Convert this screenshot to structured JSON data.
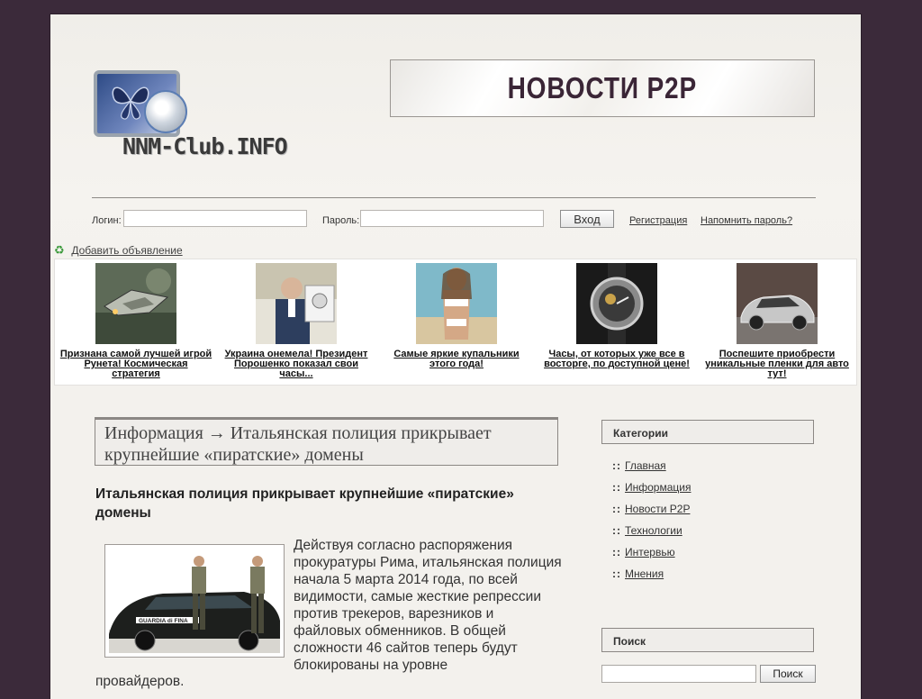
{
  "header": {
    "logo_text": "NNM-Club.INFO",
    "banner_title": "НОВОСТИ P2P"
  },
  "login": {
    "login_label": "Логин:",
    "password_label": "Пароль:",
    "login_value": "",
    "password_value": "",
    "submit_label": "Вход",
    "register_link": "Регистрация",
    "forgot_link": "Напомнить пароль?"
  },
  "ads": {
    "add_label": "Добавить объявление",
    "items": [
      {
        "caption": "Признана самой лучшей игрой Рунета! Космическая стратегия"
      },
      {
        "caption": "Украина онемела! Президент Порошенко показал свои часы..."
      },
      {
        "caption": "Самые яркие купальники этого года!"
      },
      {
        "caption": "Часы, от которых уже все в восторге, по доступной цене!"
      },
      {
        "caption": "Поспешите приобрести уникальные пленки для авто тут!"
      }
    ]
  },
  "article": {
    "breadcrumb": "Информация → Итальянская полиция прикрывает крупнейшие «пиратские» домены",
    "title": "Итальянская полиция прикрывает крупнейшие «пиратские» домены",
    "body": "Действуя согласно распоряжения прокуратуры Рима, итальянская полиция начала 5 марта 2014 года, по всей видимости, самые жесткие репрессии против трекеров, варезников и файловых обменников. В общей сложности 46 сайтов теперь будут блокированы на уровне",
    "body_tail": "провайдеров.",
    "photo_car_text": "GUARDIA di FINA"
  },
  "sidebar": {
    "categories_title": "Категории",
    "bullet": "::",
    "categories": [
      {
        "label": "Главная"
      },
      {
        "label": "Информация"
      },
      {
        "label": "Новости P2P"
      },
      {
        "label": "Технологии"
      },
      {
        "label": "Интервью"
      },
      {
        "label": "Мнения"
      }
    ],
    "search_title": "Поиск",
    "search_value": "",
    "search_button": "Поиск"
  },
  "colors": {
    "frame": "#3b2a3a",
    "banner_text": "#3a2536",
    "panel_border": "#8b8784"
  }
}
